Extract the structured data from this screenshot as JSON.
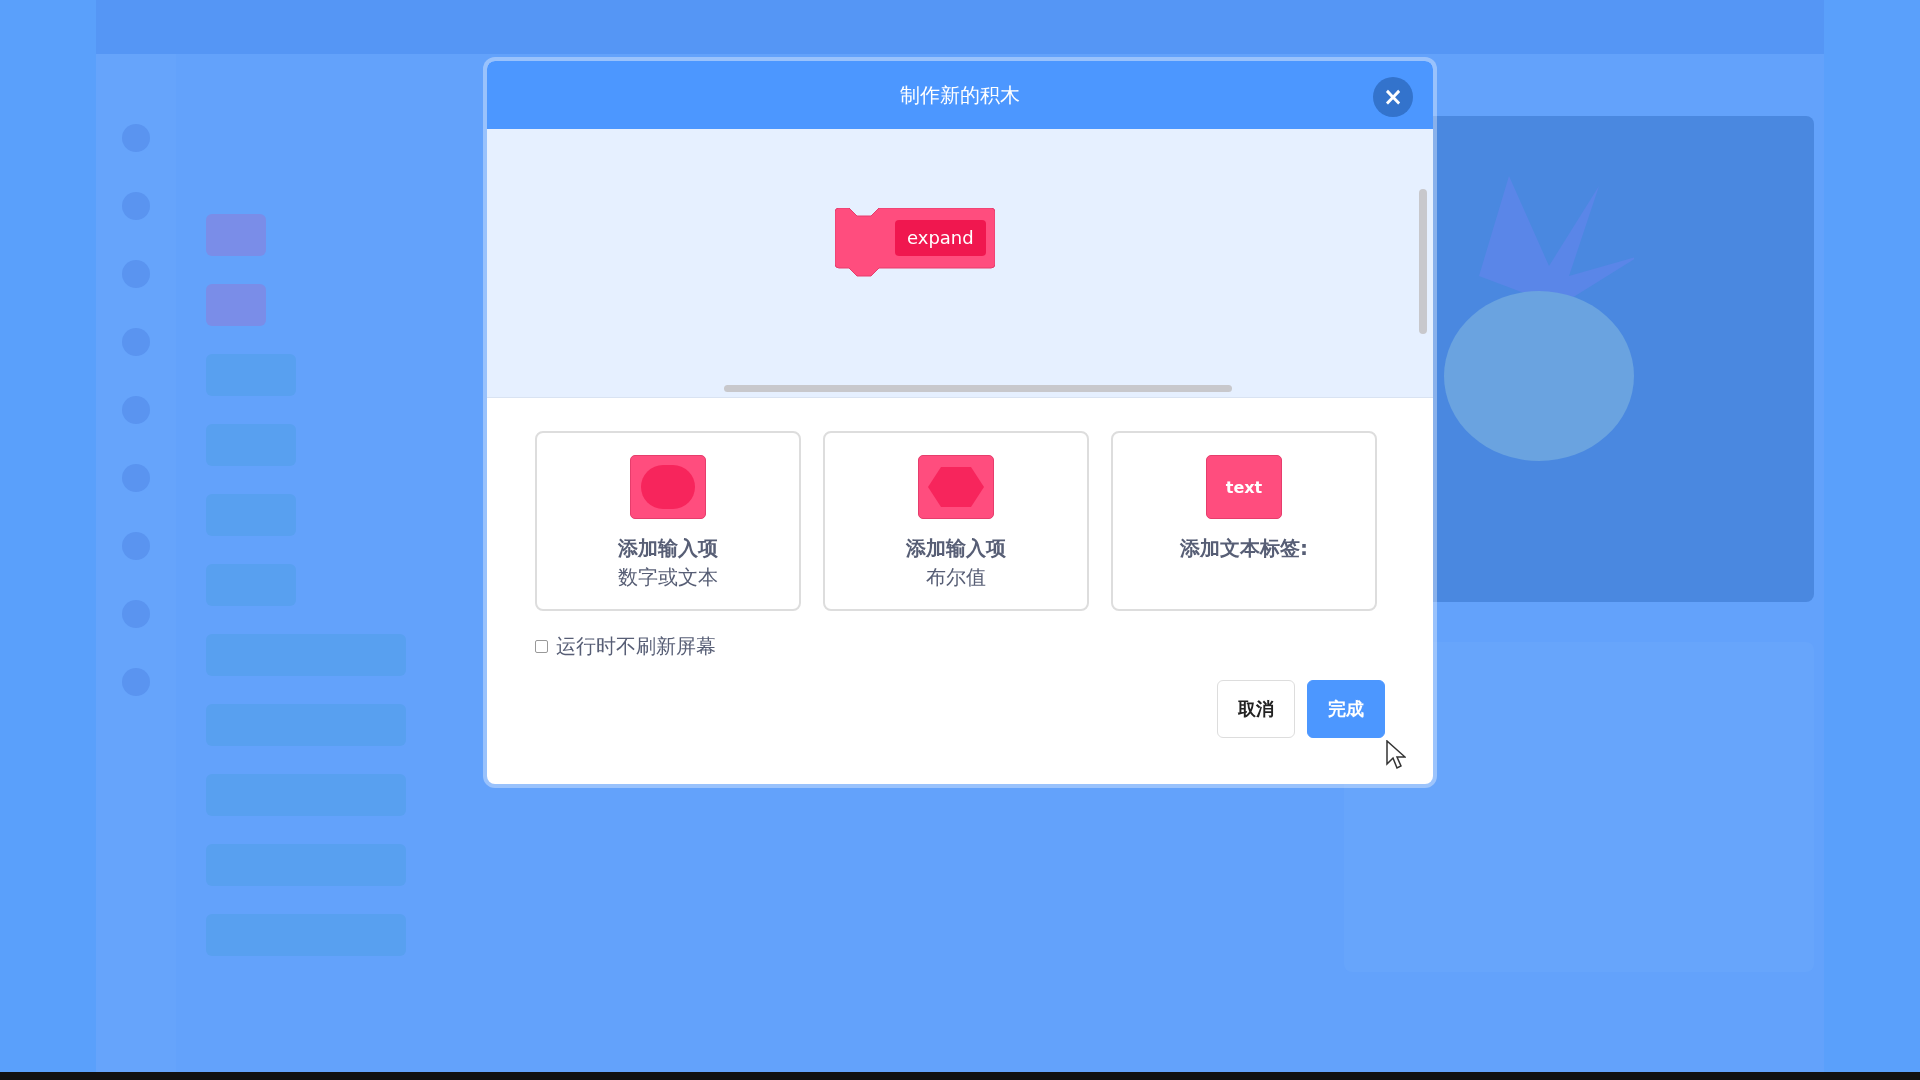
{
  "dialog": {
    "title": "制作新的积木",
    "close_label": "×",
    "preview_block": {
      "input_text": "expand"
    },
    "options": [
      {
        "kind": "number_text",
        "title": "添加输入项",
        "subtitle": "数字或文本"
      },
      {
        "kind": "boolean",
        "title": "添加输入项",
        "subtitle": "布尔值"
      },
      {
        "kind": "label",
        "title": "添加文本标签:",
        "icon_text": "text"
      }
    ],
    "run_without_refresh": {
      "label": "运行时不刷新屏幕",
      "checked": false
    },
    "buttons": [
      {
        "kind": "secondary",
        "label": "取消"
      },
      {
        "kind": "primary",
        "label": "完成"
      }
    ]
  }
}
